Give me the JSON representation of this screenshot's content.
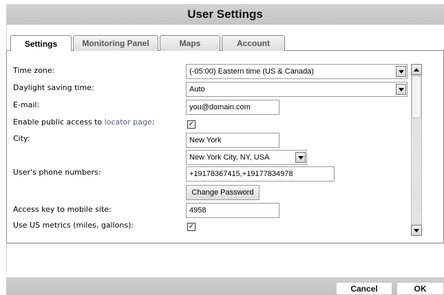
{
  "window": {
    "title": "User Settings"
  },
  "tabs": [
    {
      "label": "Settings",
      "active": true
    },
    {
      "label": "Monitoring Panel",
      "active": false
    },
    {
      "label": "Maps",
      "active": false
    },
    {
      "label": "Account",
      "active": false
    }
  ],
  "form": {
    "timezone": {
      "label": "Time zone:",
      "value": "(-05:00) Eastern time (US & Canada)"
    },
    "dst": {
      "label": "Daylight saving time:",
      "value": "Auto"
    },
    "email": {
      "label": "E-mail:",
      "value": "you@domain.com"
    },
    "public_access": {
      "label_prefix": "Enable public access to ",
      "label_link": "locator page",
      "label_suffix": ":",
      "checked": true
    },
    "city": {
      "label": "City:",
      "value": "New York",
      "select_value": "New York City, NY, USA"
    },
    "phones": {
      "label": "User's phone numbers:",
      "value": "+19178367415,+19177834978"
    },
    "change_password": {
      "label": "Change Password"
    },
    "access_key": {
      "label": "Access key to mobile site:",
      "value": "4958"
    },
    "us_metrics": {
      "label": "Use US metrics (miles, gallons):",
      "checked": true
    }
  },
  "footer": {
    "cancel_label": "Cancel",
    "ok_label": "OK"
  },
  "colors": {
    "link": "#4a5e8a",
    "title_bar": "#c8c8c8"
  }
}
